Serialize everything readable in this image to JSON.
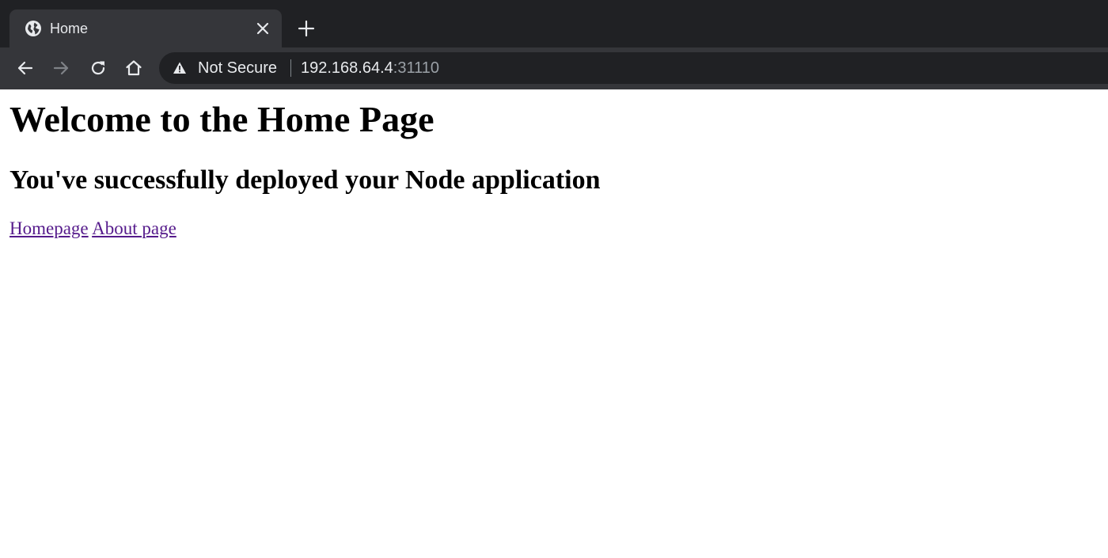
{
  "tab": {
    "title": "Home",
    "favicon": "globe-icon",
    "close_icon": "close-icon"
  },
  "new_tab_icon": "plus-icon",
  "toolbar": {
    "back_icon": "arrow-left-icon",
    "forward_icon": "arrow-right-icon",
    "reload_icon": "reload-icon",
    "home_icon": "home-icon"
  },
  "omnibox": {
    "security_icon": "warning-icon",
    "security_label": "Not Secure",
    "url_host": "192.168.64.4",
    "url_port": ":31110"
  },
  "page": {
    "heading": "Welcome to the Home Page",
    "subheading": "You've successfully deployed your Node application",
    "links": [
      {
        "label": "Homepage"
      },
      {
        "label": "About page"
      }
    ]
  },
  "colors": {
    "tabstrip_bg": "#202124",
    "toolbar_bg": "#35363a",
    "omnibox_bg": "#202124",
    "visited_link": "#551a8b"
  }
}
